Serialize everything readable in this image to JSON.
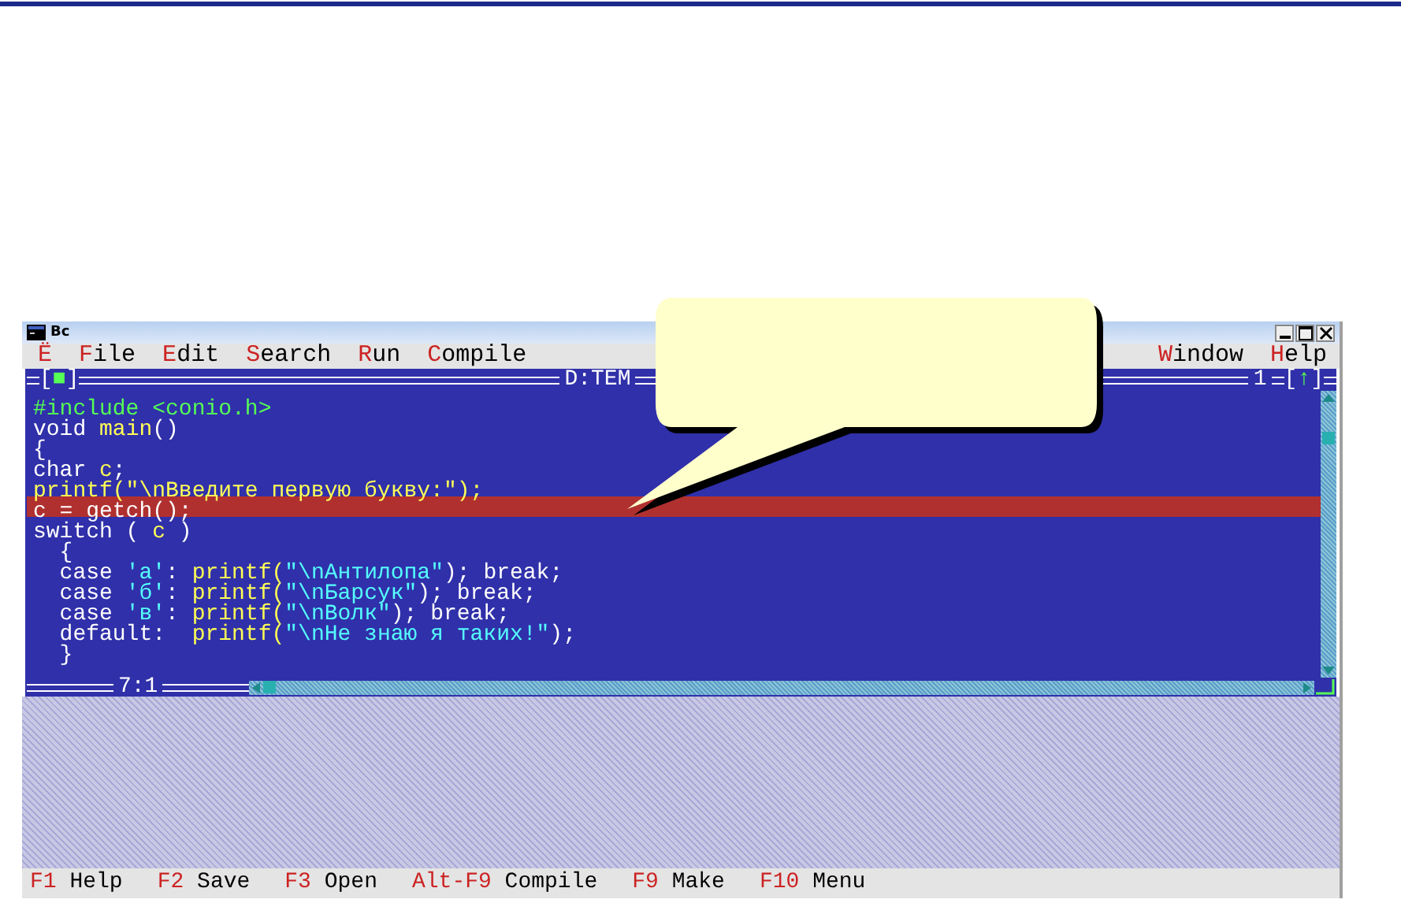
{
  "window": {
    "title": "Bc"
  },
  "menu": [
    {
      "accel": "Ё"
    },
    {
      "accel": "F",
      "rest": "ile"
    },
    {
      "accel": "E",
      "rest": "dit"
    },
    {
      "accel": "S",
      "rest": "earch"
    },
    {
      "accel": "R",
      "rest": "un"
    },
    {
      "accel": "C",
      "rest": "ompile"
    }
  ],
  "menu_right": [
    {
      "accel": "W",
      "rest": "indow"
    },
    {
      "accel": "H",
      "rest": "elp"
    }
  ],
  "editor": {
    "close_box": [
      "[",
      "■",
      "]"
    ],
    "zoom_box": [
      "[",
      "↑",
      "]"
    ],
    "file_title": "D:TEM",
    "window_number": "1",
    "position": "7:1",
    "lines": [
      {
        "selected": false,
        "segments": [
          {
            "kind": "preproc",
            "text": "#include <conio.h>"
          }
        ]
      },
      {
        "selected": false,
        "segments": [
          {
            "kind": "plain",
            "text": "void "
          },
          {
            "kind": "ident",
            "text": "main"
          },
          {
            "kind": "plain",
            "text": "()"
          }
        ]
      },
      {
        "selected": false,
        "segments": [
          {
            "kind": "plain",
            "text": "{"
          }
        ]
      },
      {
        "selected": false,
        "segments": [
          {
            "kind": "plain",
            "text": "char "
          },
          {
            "kind": "ident",
            "text": "c"
          },
          {
            "kind": "plain",
            "text": ";"
          }
        ]
      },
      {
        "selected": false,
        "segments": [
          {
            "kind": "ident",
            "text": "printf(\"\\nВведите первую букву:\");"
          }
        ]
      },
      {
        "selected": true,
        "segments": [
          {
            "kind": "plain",
            "text": "c = getch();"
          }
        ]
      },
      {
        "selected": false,
        "segments": [
          {
            "kind": "plain",
            "text": "switch ( "
          },
          {
            "kind": "ident",
            "text": "c"
          },
          {
            "kind": "plain",
            "text": " )"
          }
        ]
      },
      {
        "selected": false,
        "segments": [
          {
            "kind": "plain",
            "text": "  {"
          }
        ]
      },
      {
        "selected": false,
        "segments": [
          {
            "kind": "plain",
            "text": "  case "
          },
          {
            "kind": "string",
            "text": "'а'"
          },
          {
            "kind": "plain",
            "text": ": "
          },
          {
            "kind": "ident",
            "text": "printf("
          },
          {
            "kind": "string",
            "text": "\"\\nАнтилопа\""
          },
          {
            "kind": "plain",
            "text": "); break;"
          }
        ]
      },
      {
        "selected": false,
        "segments": [
          {
            "kind": "plain",
            "text": "  case "
          },
          {
            "kind": "string",
            "text": "'б'"
          },
          {
            "kind": "plain",
            "text": ": "
          },
          {
            "kind": "ident",
            "text": "printf("
          },
          {
            "kind": "string",
            "text": "\"\\nБарсук\""
          },
          {
            "kind": "plain",
            "text": "); break;"
          }
        ]
      },
      {
        "selected": false,
        "segments": [
          {
            "kind": "plain",
            "text": "  case "
          },
          {
            "kind": "string",
            "text": "'в'"
          },
          {
            "kind": "plain",
            "text": ": "
          },
          {
            "kind": "ident",
            "text": "printf("
          },
          {
            "kind": "string",
            "text": "\"\\nВолк\""
          },
          {
            "kind": "plain",
            "text": "); break;"
          }
        ]
      },
      {
        "selected": false,
        "segments": [
          {
            "kind": "plain",
            "text": "  default:  "
          },
          {
            "kind": "ident",
            "text": "printf("
          },
          {
            "kind": "string",
            "text": "\"\\nНе знаю я таких!\""
          },
          {
            "kind": "plain",
            "text": ");"
          }
        ]
      },
      {
        "selected": false,
        "segments": [
          {
            "kind": "plain",
            "text": "  }"
          }
        ]
      }
    ]
  },
  "status_bar": [
    {
      "key": "F1",
      "label": "Help"
    },
    {
      "key": "F2",
      "label": "Save"
    },
    {
      "key": "F3",
      "label": "Open"
    },
    {
      "key": "Alt-F9",
      "label": "Compile"
    },
    {
      "key": "F9",
      "label": "Make"
    },
    {
      "key": "F10",
      "label": "Menu"
    }
  ]
}
